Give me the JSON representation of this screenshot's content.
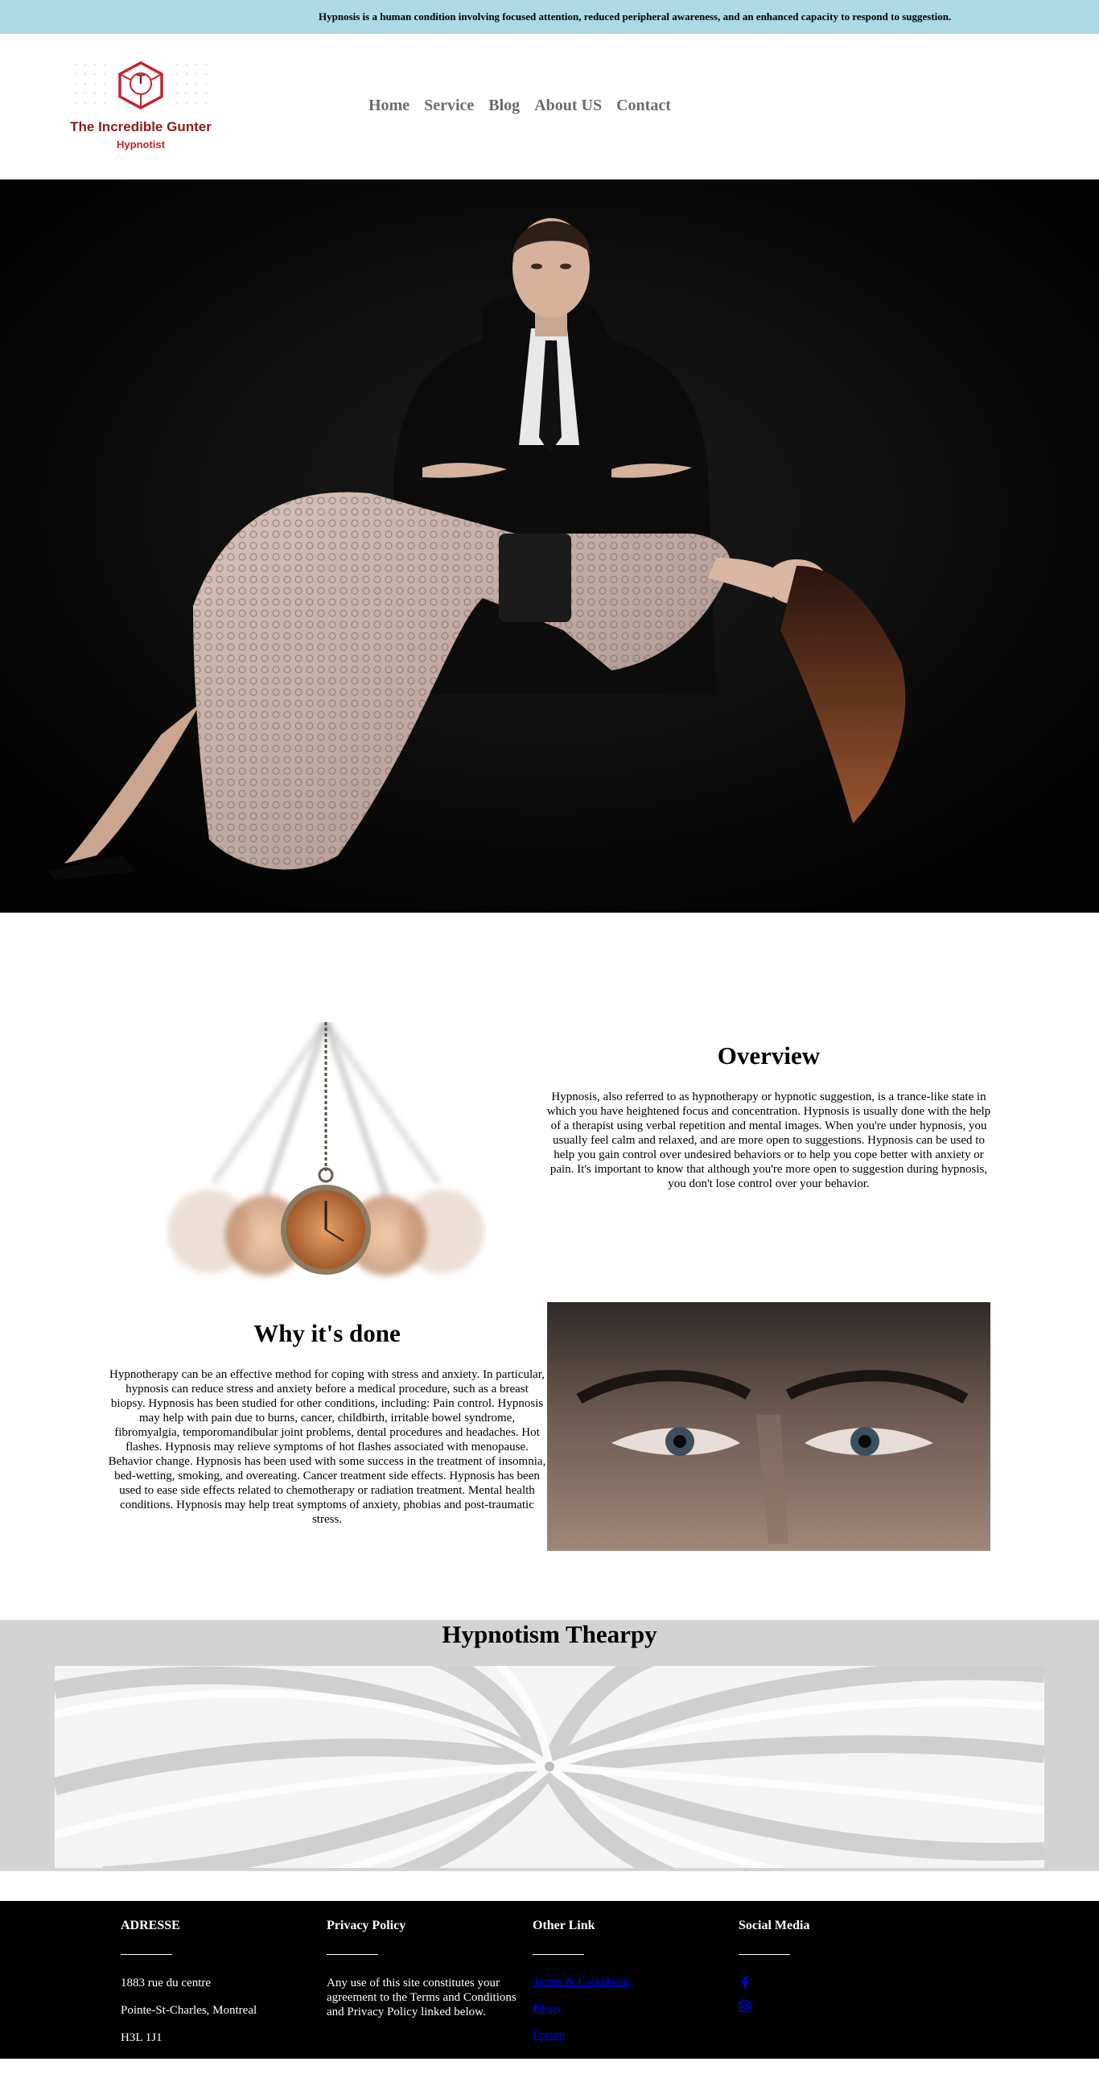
{
  "topbar": {
    "text": "Hypnosis is a human condition involving focused attention, reduced peripheral awareness, and an enhanced capacity to respond to suggestion."
  },
  "logo": {
    "letter": "T",
    "title": "The Incredible Gunter",
    "subtitle": "Hypnotist"
  },
  "nav": {
    "items": [
      "Home",
      "Service",
      "Blog",
      "About US",
      "Contact"
    ]
  },
  "overview": {
    "title": "Overview",
    "text": "Hypnosis, also referred to as hypnotherapy or hypnotic suggestion, is a trance-like state in which you have heightened focus and concentration. Hypnosis is usually done with the help of a therapist using verbal repetition and mental images. When you're under hypnosis, you usually feel calm and relaxed, and are more open to suggestions. Hypnosis can be used to help you gain control over undesired behaviors or to help you cope better with anxiety or pain. It's important to know that although you're more open to suggestion during hypnosis, you don't lose control over your behavior."
  },
  "why": {
    "title": "Why it's done",
    "text": "Hypnotherapy can be an effective method for coping with stress and anxiety. In particular, hypnosis can reduce stress and anxiety before a medical procedure, such as a breast biopsy. Hypnosis has been studied for other conditions, including: Pain control. Hypnosis may help with pain due to burns, cancer, childbirth, irritable bowel syndrome, fibromyalgia, temporomandibular joint problems, dental procedures and headaches. Hot flashes. Hypnosis may relieve symptoms of hot flashes associated with menopause. Behavior change. Hypnosis has been used with some success in the treatment of insomnia, bed-wetting, smoking, and overeating. Cancer treatment side effects. Hypnosis has been used to ease side effects related to chemotherapy or radiation treatment. Mental health conditions. Hypnosis may help treat symptoms of anxiety, phobias and post-traumatic stress."
  },
  "therapy": {
    "title": "Hypnotism Thearpy"
  },
  "footer": {
    "address": {
      "heading": "ADRESSE",
      "line1": "1883 rue du centre",
      "line2": "Pointe-St-Charles, Montreal",
      "line3": "H3L 1J1"
    },
    "privacy": {
      "heading": "Privacy Policy",
      "text": "Any use of this site constitutes your agreement to the Terms and Conditions and Privacy Policy linked below."
    },
    "links": {
      "heading": "Other Link",
      "items": [
        "Terms & Conditions",
        "Blogs",
        "Forum"
      ]
    },
    "social": {
      "heading": "Social Media",
      "icons": [
        "facebook-icon",
        "instagram-icon"
      ]
    }
  },
  "colors": {
    "topbar_bg": "#add8e6",
    "nav_text": "#6b6b6b",
    "logo_red": "#c8232c",
    "band_bg": "#d3d3d3",
    "footer_bg": "#000000",
    "link": "#0000ee"
  }
}
